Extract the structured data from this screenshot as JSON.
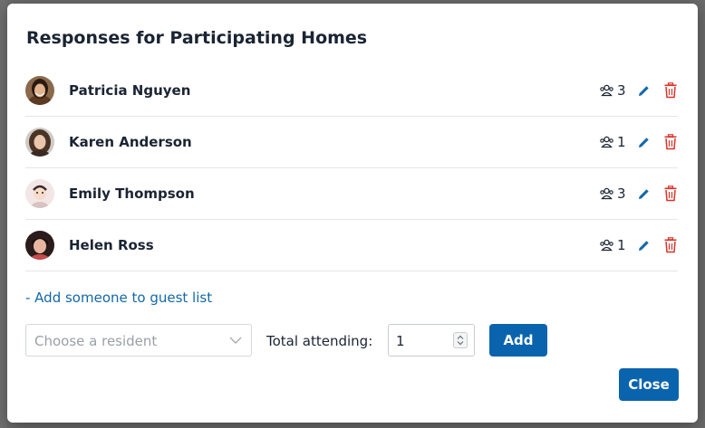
{
  "dialog": {
    "title": "Responses for Participating Homes"
  },
  "responses": [
    {
      "name": "Patricia Nguyen",
      "count": "3"
    },
    {
      "name": "Karen Anderson",
      "count": "1"
    },
    {
      "name": "Emily Thompson",
      "count": "3"
    },
    {
      "name": "Helen Ross",
      "count": "1"
    }
  ],
  "icons": {
    "guests": "guests-icon",
    "edit": "pencil-icon",
    "delete": "trash-icon"
  },
  "add_section": {
    "link_label": "- Add someone to guest list",
    "resident_placeholder": "Choose a resident",
    "total_label": "Total attending:",
    "total_value": "1",
    "add_label": "Add"
  },
  "footer": {
    "close_label": "Close"
  },
  "colors": {
    "primary": "#0a64ad",
    "link": "#1368a8",
    "delete": "#d9342b",
    "edit": "#1368a8"
  }
}
